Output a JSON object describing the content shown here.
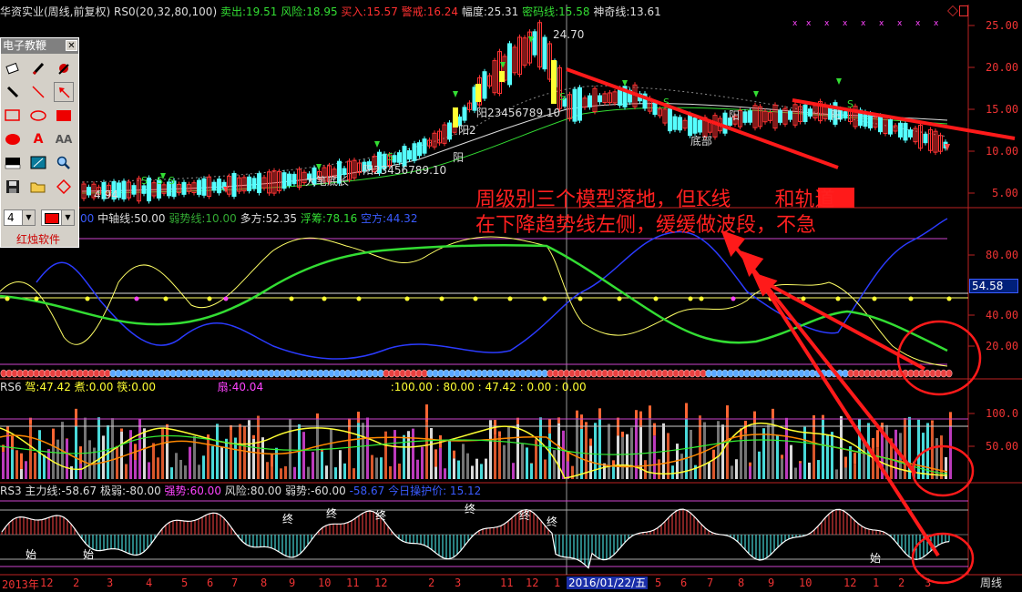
{
  "main_header": {
    "stock": "华资实业(周线,前复权)",
    "indicator": "RS0(20,32,80,100)",
    "sell_label": "卖出:",
    "sell_value": "19.51",
    "risk_label": "风险:",
    "risk_value": "18.95",
    "buy_label": "买入:",
    "buy_value": "15.57",
    "alert_label": "警戒:",
    "alert_value": "16.24",
    "range_label": "幅度:",
    "range_value": "25.31",
    "secret_label": "密码线:",
    "secret_value": "15.58",
    "magic_label": "神奇线:",
    "magic_value": "13.61"
  },
  "main_chart": {
    "price_axis": [
      "25.00",
      "20.00",
      "15.00",
      "10.00",
      "5.00"
    ],
    "high_marker": "24.70",
    "low_marker": "4.94",
    "annotations": [
      "阳23456789.10",
      "阳23456789.10",
      "阳2",
      "阳",
      "大笔底长",
      "底部",
      "阳",
      "阳",
      "S",
      "S",
      "S",
      "S"
    ]
  },
  "panel2": {
    "header_prefix": "00",
    "mid_label": "中轴线:",
    "mid_value": "50.00",
    "weak_label": "弱势线:",
    "weak_value": "10.00",
    "long_label": "多方:",
    "long_value": "52.35",
    "float_label": "浮筹:",
    "float_value": "78.16",
    "short_label": "空方:",
    "short_value": "44.32",
    "axis": [
      "80.00",
      "40.00",
      "20.00"
    ],
    "marker": "54.58"
  },
  "panel3": {
    "name": "RS6",
    "a_label": "驾:",
    "a_value": "47.42",
    "b_label": "煮:",
    "b_value": "0.00",
    "c_label": "筷:",
    "c_value": "0.00",
    "d_label": "扇:",
    "d_value": "40.04",
    "tail": ":100.00 : 80.00 : 47.42 : 0.00 : 0.00",
    "axis": [
      "100.0",
      "50.00"
    ]
  },
  "panel4": {
    "name": "RS3",
    "main_label": "主力线:",
    "main_value": "-58.67",
    "weak_label": "极弱:",
    "weak_value": "-80.00",
    "strong_label": "强势:",
    "strong_value": "60.00",
    "risk_label": "风险:",
    "risk_value": "80.00",
    "fragile_label": "弱势:",
    "fragile_value": "-60.00",
    "tail": "-58.67 今日操护价: 15.12",
    "marks": [
      "始",
      "始",
      "始",
      "终",
      "终",
      "终",
      "终",
      "终",
      "终"
    ]
  },
  "x_axis": {
    "labels": [
      "2013年",
      "12",
      "2",
      "3",
      "4",
      "5",
      "6",
      "7",
      "8",
      "9",
      "10",
      "11",
      "12",
      "2",
      "3",
      "11",
      "12",
      "1",
      "5",
      "6",
      "7",
      "8",
      "9",
      "10",
      "12",
      "1",
      "2",
      "3"
    ],
    "cursor_date": "2016/01/22/五",
    "period": "周线"
  },
  "annotation": {
    "line1": "周级别三个模型落地，但K线",
    "line1b": "和轨道",
    "line2": "在下降趋势线左侧，缓缓做波段，不急"
  },
  "toolbox": {
    "title": "电子教鞭",
    "width_value": "4",
    "brand": "红烛软件",
    "tools": [
      "eraser-icon",
      "pen-icon",
      "brush-icon",
      "pencil-icon",
      "line-icon",
      "arrow-icon",
      "rect-icon",
      "ellipse-icon",
      "filled-rect-icon",
      "filled-ellipse-icon",
      "text-icon",
      "text-size-icon",
      "black-rect-icon",
      "image-icon",
      "zoom-icon",
      "save-icon",
      "open-icon",
      "diamond-icon"
    ]
  },
  "colors": {
    "axis": "#e33232",
    "red": "#ff2020",
    "green": "#33dd33",
    "yellow": "#ffff00",
    "blue": "#2b3bff",
    "cyan": "#55ffff",
    "magenta": "#ff44ff"
  }
}
